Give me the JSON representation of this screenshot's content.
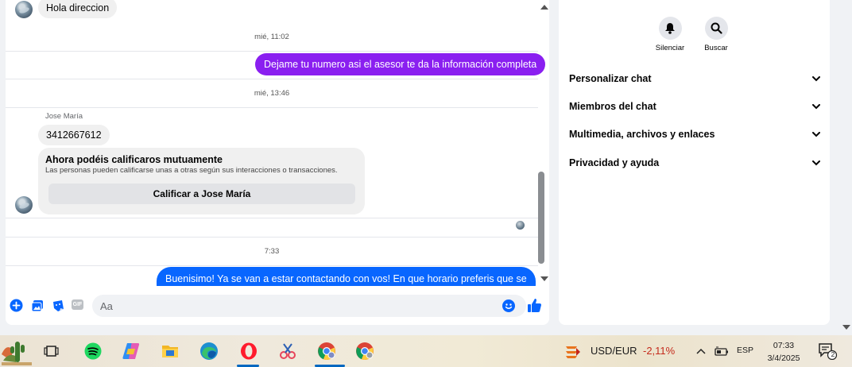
{
  "chat": {
    "messages": {
      "top_incoming": "Hola direccion",
      "ts1": "mié, 11:02",
      "outgoing1": "Dejame tu numero asi el asesor te da la información completa",
      "ts2": "mié, 13:46",
      "sender_name": "Jose María",
      "incoming_phone": "3412667612",
      "ts3": "7:33",
      "outgoing2": "Buenisimo! Ya se van a estar contactando con vos! En que horario preferis que se"
    },
    "rating_card": {
      "title": "Ahora podéis calificaros mutuamente",
      "description": "Las personas pueden calificarse unas a otras según sus interacciones o transacciones.",
      "button": "Calificar a Jose María"
    },
    "composer": {
      "placeholder": "Aa",
      "gif_label": "GIF"
    },
    "colors": {
      "outgoing_purple": "#8a1ff0",
      "outgoing_blue": "#0866ff",
      "accent": "#0866ff"
    }
  },
  "info_panel": {
    "actions": [
      {
        "label": "Silenciar",
        "icon": "bell-icon"
      },
      {
        "label": "Buscar",
        "icon": "search-icon"
      }
    ],
    "sections": [
      {
        "label": "Personalizar chat"
      },
      {
        "label": "Miembros del chat"
      },
      {
        "label": "Multimedia, archivos y enlaces"
      },
      {
        "label": "Privacidad y ayuda"
      }
    ]
  },
  "taskbar": {
    "apps": [
      "widgets-icon",
      "task-view-icon",
      "spotify-icon",
      "copilot-icon",
      "file-explorer-icon",
      "edge-icon",
      "opera-icon",
      "snipping-tool-icon",
      "chrome-icon",
      "chrome-profile-icon"
    ],
    "ticker": {
      "label": "USD/EUR",
      "value": "-2,11%"
    },
    "language": "ESP",
    "time": "07:33",
    "date": "3/4/2025",
    "notification_count": "2"
  }
}
